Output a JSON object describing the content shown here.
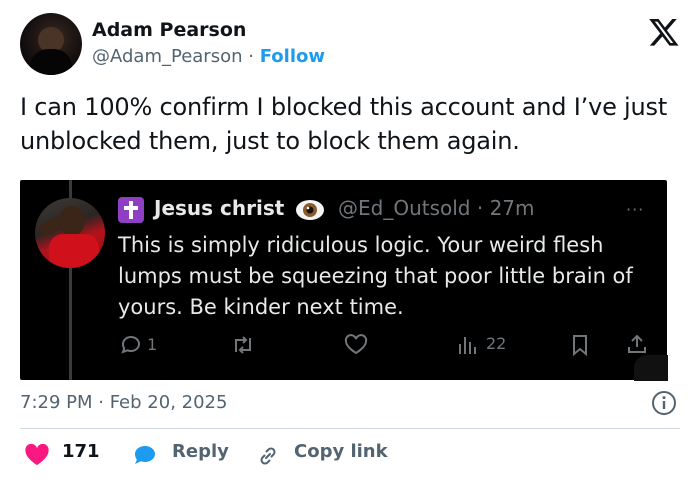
{
  "author": {
    "name": "Adam Pearson",
    "handle": "@Adam_Pearson",
    "separator": "·",
    "follow_label": "Follow"
  },
  "tweet_text": "I can 100% confirm I blocked this account and I’ve just unblocked them, just to block them again.",
  "quoted": {
    "name": "Jesus christ",
    "handle": "@Ed_Outsold",
    "age": "27m",
    "text": "This is simply ridiculous logic. Your weird flesh lumps must be squeezing that poor little brain of yours. Be kinder next time.",
    "reply_count": "1",
    "view_count": "22",
    "more_label": "···"
  },
  "timestamp": "7:29 PM · Feb 20, 2025",
  "footer": {
    "like_count": "171",
    "reply_label": "Reply",
    "copy_label": "Copy link"
  },
  "colors": {
    "accent": "#1d9bf0",
    "like": "#f91880",
    "muted": "#536471",
    "quote_bg": "#000000"
  }
}
